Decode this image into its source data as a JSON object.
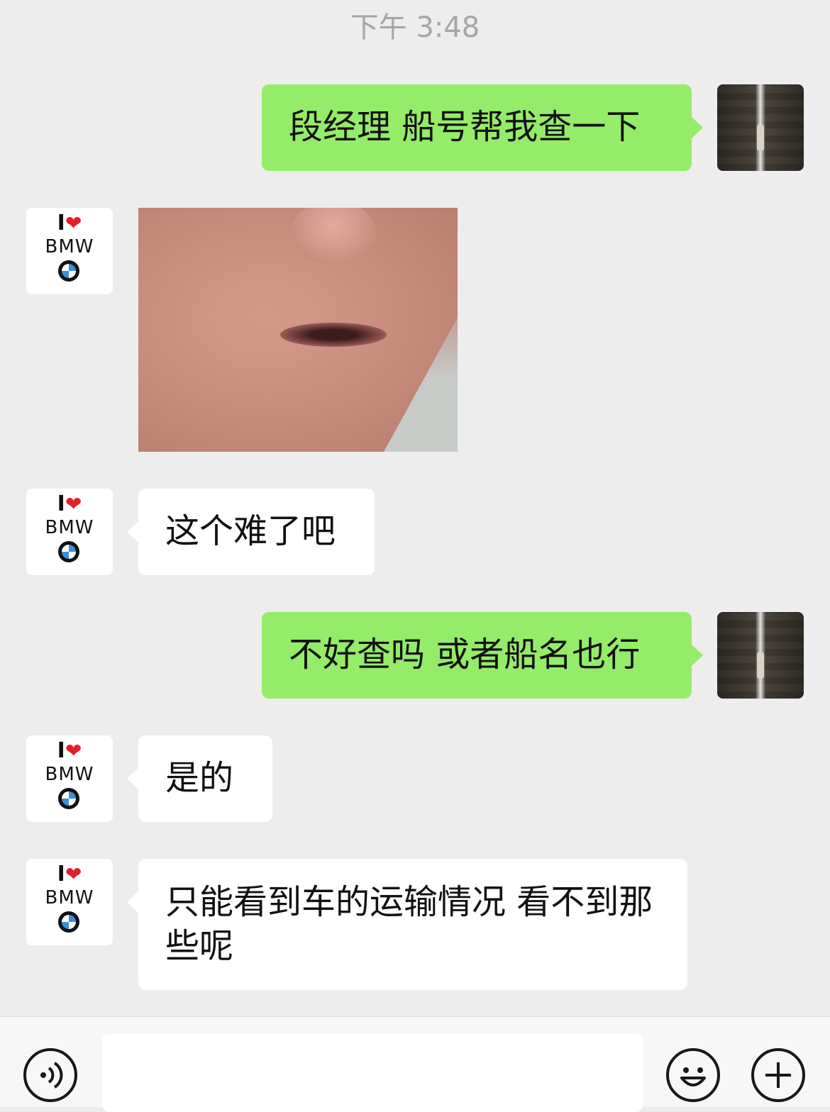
{
  "timestamp": "下午 3:48",
  "messages": [
    {
      "side": "self",
      "text": "段经理 船号帮我查一下"
    },
    {
      "side": "other",
      "type": "sticker",
      "text": ""
    },
    {
      "side": "other",
      "text": "这个难了吧"
    },
    {
      "side": "self",
      "text": "不好查吗 或者船名也行"
    },
    {
      "side": "other",
      "text": "是的"
    },
    {
      "side": "other",
      "text": "只能看到车的运输情况  看不到那些呢"
    }
  ],
  "contact_avatar": {
    "line1": "I",
    "heart": "❤",
    "line2": "BMW"
  },
  "bottom_bar": {
    "voice_icon": "voice-icon",
    "emoji_icon": "emoji-icon",
    "plus_icon": "plus-icon",
    "emoji_glyph": "☺",
    "plus_glyph": "+"
  },
  "colors": {
    "self_bubble": "#95ec69",
    "other_bubble": "#ffffff",
    "background": "#ededed"
  }
}
